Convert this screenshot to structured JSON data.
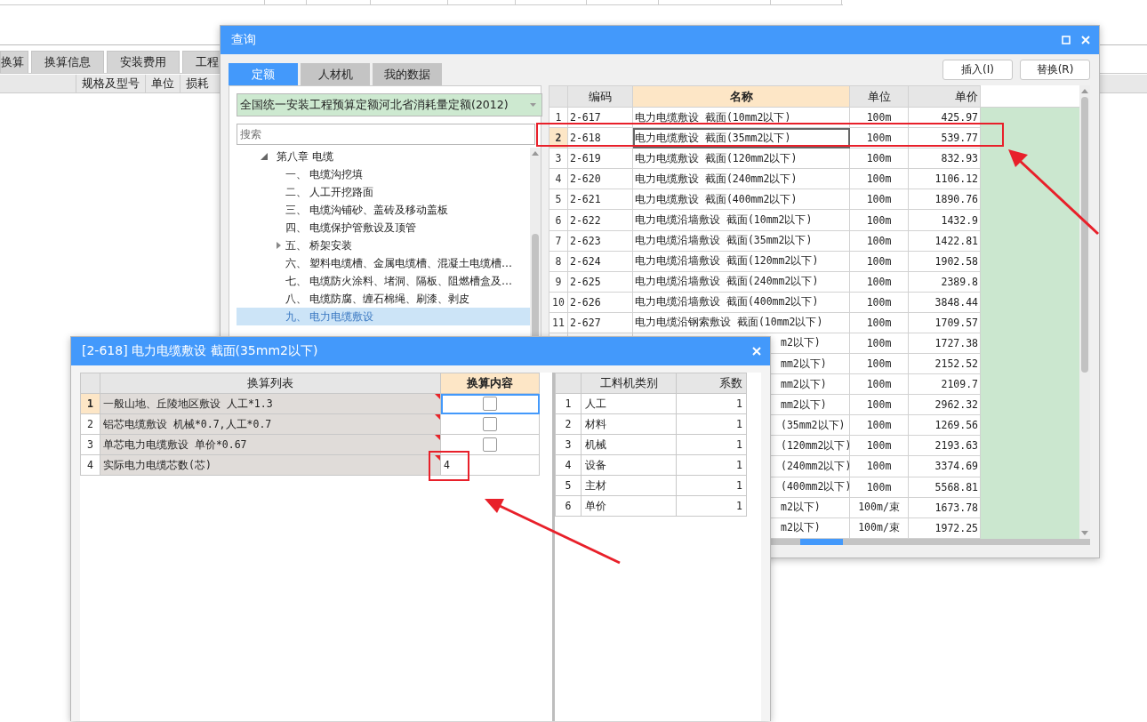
{
  "background_window": {
    "tabs": [
      {
        "label": "换算",
        "selected": false
      },
      {
        "label": "换算信息",
        "selected": false
      },
      {
        "label": "安装费用",
        "selected": false
      },
      {
        "label": "工程",
        "selected": false
      }
    ],
    "columns": [
      "规格及型号",
      "单位",
      "损耗"
    ]
  },
  "query_dialog": {
    "title": "查询",
    "tabs": [
      {
        "label": "定额",
        "selected": true
      },
      {
        "label": "人材机",
        "selected": false
      },
      {
        "label": "我的数据",
        "selected": false
      }
    ],
    "buttons": [
      "插入(I)",
      "替换(R)"
    ],
    "library": {
      "value": "全国统一安装工程预算定额河北省消耗量定额(2012)"
    },
    "search": {
      "placeholder": "搜索"
    },
    "tree": [
      {
        "label": "第八章 电缆",
        "expanded": true,
        "children": [
          {
            "number": "一、",
            "label": "电缆沟挖填",
            "kind": "leaf",
            "selected": false
          },
          {
            "number": "二、",
            "label": "人工开挖路面",
            "kind": "leaf",
            "selected": false
          },
          {
            "number": "三、",
            "label": "电缆沟铺砂、盖砖及移动盖板",
            "kind": "leaf",
            "selected": false
          },
          {
            "number": "四、",
            "label": "电缆保护管敷设及顶管",
            "kind": "leaf",
            "selected": false
          },
          {
            "number": "五、",
            "label": "桥架安装",
            "kind": "group",
            "selected": false
          },
          {
            "number": "六、",
            "label": "塑料电缆槽、金属电缆槽、混凝土电缆槽…",
            "kind": "leaf",
            "selected": false
          },
          {
            "number": "七、",
            "label": "电缆防火涂料、堵洞、隔板、阻燃槽盒及…",
            "kind": "leaf",
            "selected": false
          },
          {
            "number": "八、",
            "label": "电缆防腐、缠石棉绳、刷漆、剥皮",
            "kind": "leaf",
            "selected": false
          },
          {
            "number": "九、",
            "label": "电力电缆敷设",
            "kind": "leaf",
            "selected": true
          }
        ]
      }
    ],
    "table": {
      "columns": [
        {
          "label": "编码",
          "selected": false
        },
        {
          "label": "名称",
          "selected": true
        },
        {
          "label": "单位",
          "selected": false
        },
        {
          "label": "单价",
          "selected": false
        }
      ],
      "rows": [
        {
          "number": "1",
          "code": "2-617",
          "name": "电力电缆敷设 截面(10mm2以下)",
          "unit": "100m",
          "price": "425.97",
          "selected": false
        },
        {
          "number": "2",
          "code": "2-618",
          "name": "电力电缆敷设 截面(35mm2以下)",
          "unit": "100m",
          "price": "539.77",
          "selected": true
        },
        {
          "number": "3",
          "code": "2-619",
          "name": "电力电缆敷设 截面(120mm2以下)",
          "unit": "100m",
          "price": "832.93",
          "selected": false
        },
        {
          "number": "4",
          "code": "2-620",
          "name": "电力电缆敷设 截面(240mm2以下)",
          "unit": "100m",
          "price": "1106.12",
          "selected": false
        },
        {
          "number": "5",
          "code": "2-621",
          "name": "电力电缆敷设 截面(400mm2以下)",
          "unit": "100m",
          "price": "1890.76",
          "selected": false
        },
        {
          "number": "6",
          "code": "2-622",
          "name": "电力电缆沿墙敷设 截面(10mm2以下)",
          "unit": "100m",
          "price": "1432.9",
          "selected": false
        },
        {
          "number": "7",
          "code": "2-623",
          "name": "电力电缆沿墙敷设 截面(35mm2以下)",
          "unit": "100m",
          "price": "1422.81",
          "selected": false
        },
        {
          "number": "8",
          "code": "2-624",
          "name": "电力电缆沿墙敷设 截面(120mm2以下)",
          "unit": "100m",
          "price": "1902.58",
          "selected": false
        },
        {
          "number": "9",
          "code": "2-625",
          "name": "电力电缆沿墙敷设 截面(240mm2以下)",
          "unit": "100m",
          "price": "2389.8",
          "selected": false
        },
        {
          "number": "10",
          "code": "2-626",
          "name": "电力电缆沿墙敷设 截面(400mm2以下)",
          "unit": "100m",
          "price": "3848.44",
          "selected": false
        },
        {
          "number": "11",
          "code": "2-627",
          "name": "电力电缆沿钢索敷设 截面(10mm2以下)",
          "unit": "100m",
          "price": "1709.57",
          "selected": false
        },
        {
          "kind": "covered",
          "name": "m2以下)",
          "unit": "100m",
          "price": "1727.38",
          "selected": false
        },
        {
          "kind": "covered",
          "name": "mm2以下)",
          "unit": "100m",
          "price": "2152.52",
          "selected": false
        },
        {
          "kind": "covered",
          "name": "mm2以下)",
          "unit": "100m",
          "price": "2109.7",
          "selected": false
        },
        {
          "kind": "covered",
          "name": "mm2以下)",
          "unit": "100m",
          "price": "2962.32",
          "selected": false
        },
        {
          "kind": "covered",
          "name": "(35mm2以下)",
          "unit": "100m",
          "price": "1269.56",
          "selected": false
        },
        {
          "kind": "covered",
          "name": "(120mm2以下)",
          "unit": "100m",
          "price": "2193.63",
          "selected": false
        },
        {
          "kind": "covered",
          "name": "(240mm2以下)",
          "unit": "100m",
          "price": "3374.69",
          "selected": false
        },
        {
          "kind": "covered",
          "name": "(400mm2以下)",
          "unit": "100m",
          "price": "5568.81",
          "selected": false
        },
        {
          "kind": "covered",
          "name": "m2以下)",
          "unit": "100m/束",
          "price": "1673.78",
          "selected": false
        },
        {
          "kind": "covered",
          "name": "m2以下)",
          "unit": "100m/束",
          "price": "1972.25",
          "selected": false
        }
      ]
    }
  },
  "detail_dialog": {
    "title": "[2-618] 电力电缆敷设 截面(35mm2以下)",
    "adjust_table": {
      "columns": [
        {
          "label": "换算列表",
          "selected": false
        },
        {
          "label": "换算内容",
          "selected": true
        }
      ],
      "rows": [
        {
          "number": "1",
          "label": "一般山地、丘陵地区敷设 人工*1.3",
          "kind": "checkbox",
          "checked": false,
          "selected": true
        },
        {
          "number": "2",
          "label": "铝芯电缆敷设 机械*0.7,人工*0.7",
          "kind": "checkbox",
          "checked": false,
          "selected": false
        },
        {
          "number": "3",
          "label": "单芯电力电缆敷设 单价*0.67",
          "kind": "checkbox",
          "checked": false,
          "selected": false
        },
        {
          "number": "4",
          "label": "实际电力电缆芯数(芯)",
          "kind": "value",
          "value": "4",
          "selected": false
        }
      ]
    },
    "factor_table": {
      "columns": [
        "工料机类别",
        "系数"
      ],
      "rows": [
        {
          "number": "1",
          "category": "人工",
          "factor": "1"
        },
        {
          "number": "2",
          "category": "材料",
          "factor": "1"
        },
        {
          "number": "3",
          "category": "机械",
          "factor": "1"
        },
        {
          "number": "4",
          "category": "设备",
          "factor": "1"
        },
        {
          "number": "5",
          "category": "主材",
          "factor": "1"
        },
        {
          "number": "6",
          "category": "单价",
          "factor": "1"
        }
      ]
    }
  }
}
